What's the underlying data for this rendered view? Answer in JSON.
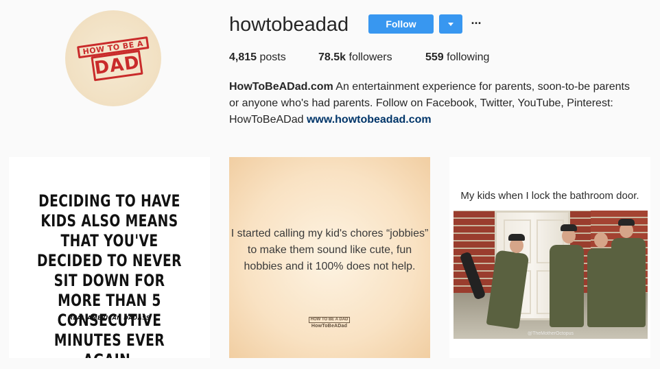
{
  "profile": {
    "username": "howtobeadad",
    "avatar_stamp_top": "HOW TO BE A",
    "avatar_stamp_bottom": "DAD",
    "follow_label": "Follow",
    "more_label": "···",
    "stats": {
      "posts_count": "4,815",
      "posts_label": "posts",
      "followers_count": "78.5k",
      "followers_label": "followers",
      "following_count": "559",
      "following_label": "following"
    },
    "bio": {
      "name": "HowToBeADad.com",
      "text": "An entertainment experience for parents, soon-to-be parents or anyone who's had parents. Follow on Facebook, Twitter, YouTube, Pinterest: HowToBeADad",
      "link": "www.howtobeadad.com"
    }
  },
  "posts": [
    {
      "text": "DECIDING TO HAVE KIDS ALSO MEANS THAT YOU'VE DECIDED TO NEVER SIT DOWN FOR MORE THAN 5 CONSECUTIVE MINUTES EVER AGAIN.",
      "signature": "REAL AMERICAN DADASS"
    },
    {
      "text": "I started calling my kid's chores “jobbies” to make them sound like cute, fun hobbies and it 100% does not help.",
      "logo_small": "HOW TO BE A DAD",
      "logo_name": "HowToBeADad"
    },
    {
      "caption": "My kids when I lock the bathroom door.",
      "watermark": "@TheMotherOctopus"
    }
  ],
  "colors": {
    "follow_blue": "#3897f0",
    "link_blue": "#003569",
    "stamp_red": "#c92b2b",
    "background": "#fafafa"
  }
}
